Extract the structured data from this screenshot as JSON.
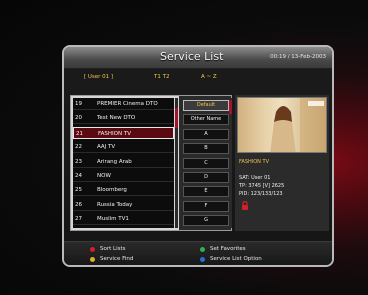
{
  "title": "Service List",
  "clock": "00:19 / 13-Feb-2003",
  "tabs": {
    "user": "[ User 01 ]",
    "t1t2": "T1 T2",
    "az": "A ~ Z"
  },
  "channels": [
    {
      "num": "19",
      "name": "PREMIER Cinema DTO"
    },
    {
      "num": "20",
      "name": "Test New DTO"
    },
    {
      "num": "21",
      "name": "FASHION TV"
    },
    {
      "num": "22",
      "name": "AAJ TV"
    },
    {
      "num": "23",
      "name": "Arirang Arab"
    },
    {
      "num": "24",
      "name": "NOW"
    },
    {
      "num": "25",
      "name": "Bloomberg"
    },
    {
      "num": "26",
      "name": "Russia Today"
    },
    {
      "num": "27",
      "name": "Muslim TV1"
    }
  ],
  "selected_index": 2,
  "sort_options": [
    "Default",
    "Other Name",
    "A",
    "B",
    "C",
    "D",
    "E",
    "F",
    "G"
  ],
  "sort_active_index": 0,
  "info": {
    "channel": "FASHION TV",
    "sat": "SAT: User 01",
    "tp": "TP: 3745 [V] 2625",
    "pid": "PID: 123/133/123"
  },
  "hints": {
    "sort_lists": "Sort Lists",
    "set_favorites": "Set Favorites",
    "service_find": "Service Find",
    "service_list_option": "Service List Option"
  },
  "colors": {
    "red": "#d0202a",
    "green": "#2fb24a",
    "yellow": "#e0b020",
    "blue": "#2a6fd0",
    "selection": "#5c0a12",
    "accent": "#f0c850"
  },
  "icons": {
    "lock": "lock-icon"
  }
}
